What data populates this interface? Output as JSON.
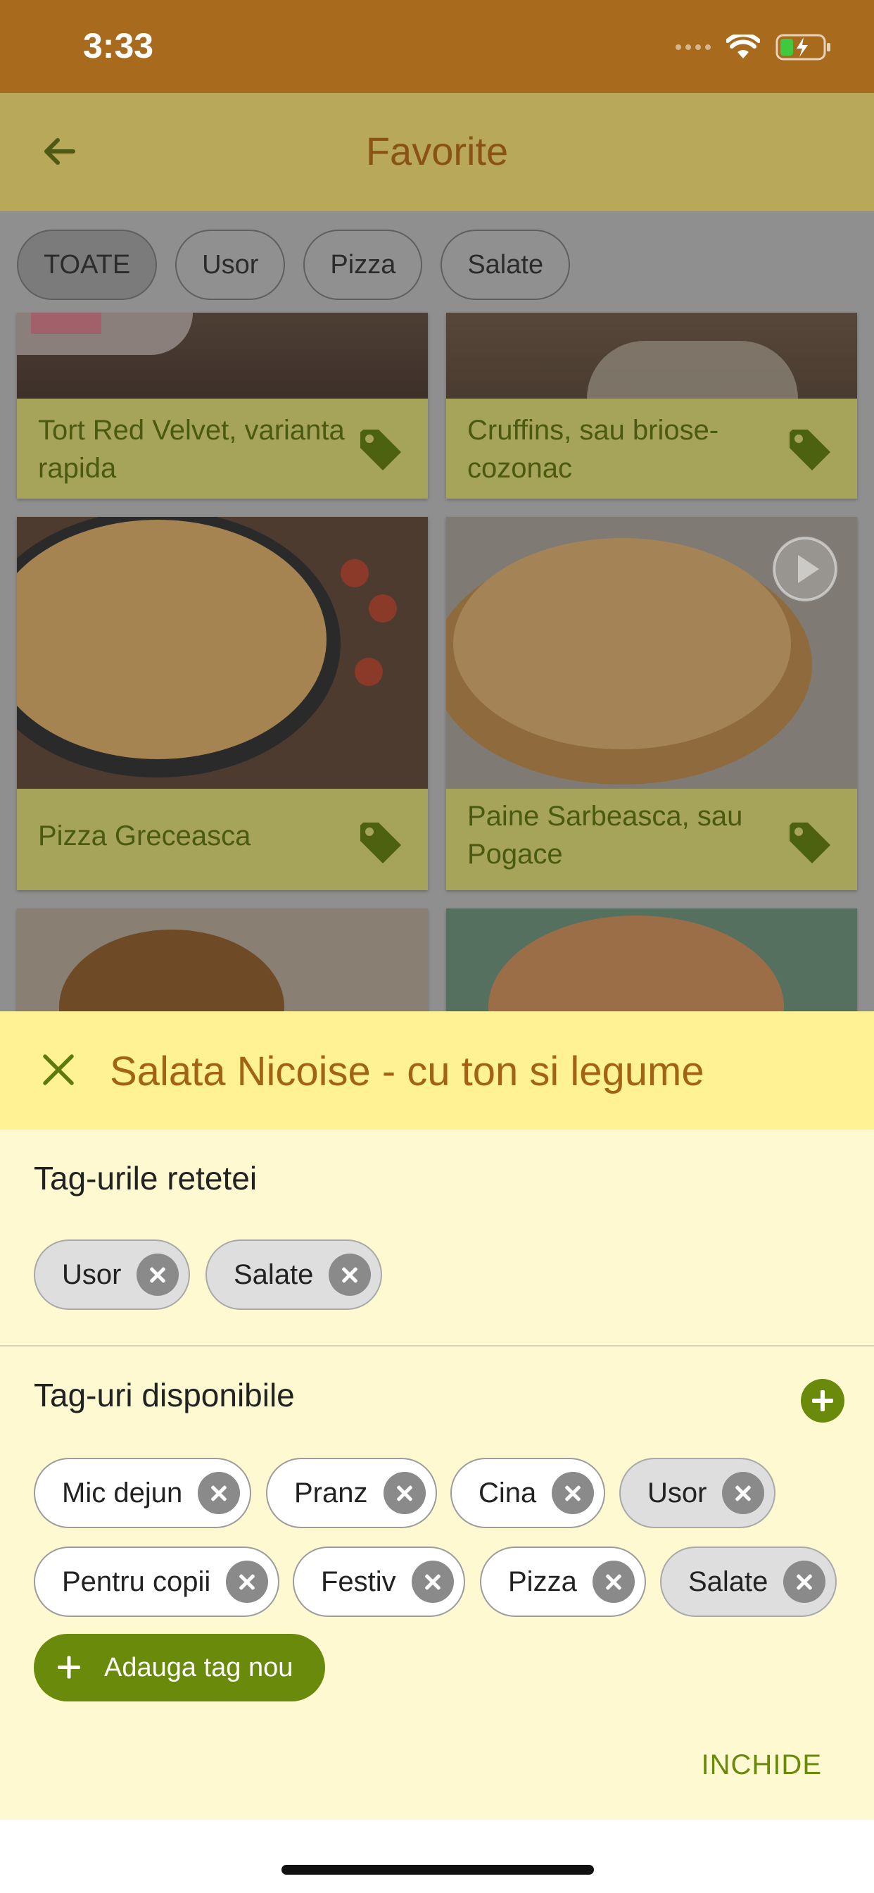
{
  "status": {
    "time": "3:33"
  },
  "app_bar": {
    "title": "Favorite"
  },
  "filters": [
    "TOATE",
    "Usor",
    "Pizza",
    "Salate"
  ],
  "cards": [
    {
      "title": "Tort Red Velvet, varianta rapida"
    },
    {
      "title": "Cruffins, sau briose-cozonac"
    },
    {
      "title": "Pizza Greceasca"
    },
    {
      "title": "Paine Sarbeasca, sau Pogace"
    }
  ],
  "sheet": {
    "title": "Salata Nicoise - cu ton si legume",
    "recipe_tags_label": "Tag-urile retetei",
    "recipe_tags": [
      "Usor",
      "Salate"
    ],
    "available_label": "Tag-uri disponibile",
    "available_tags": [
      {
        "label": "Mic dejun",
        "selected": false
      },
      {
        "label": "Pranz",
        "selected": false
      },
      {
        "label": "Cina",
        "selected": false
      },
      {
        "label": "Usor",
        "selected": true
      },
      {
        "label": "Pentru copii",
        "selected": false
      },
      {
        "label": "Festiv",
        "selected": false
      },
      {
        "label": "Pizza",
        "selected": false
      },
      {
        "label": "Salate",
        "selected": true
      }
    ],
    "add_tag_label": "Adauga tag nou",
    "close_label": "INCHIDE"
  },
  "colors": {
    "status_bar": "#a86b1e",
    "app_bar": "#b8a85a",
    "sheet_header": "#fff294",
    "sheet_body": "#fff9d2",
    "accent_green": "#6a8a0c",
    "title_brown": "#a26315"
  }
}
